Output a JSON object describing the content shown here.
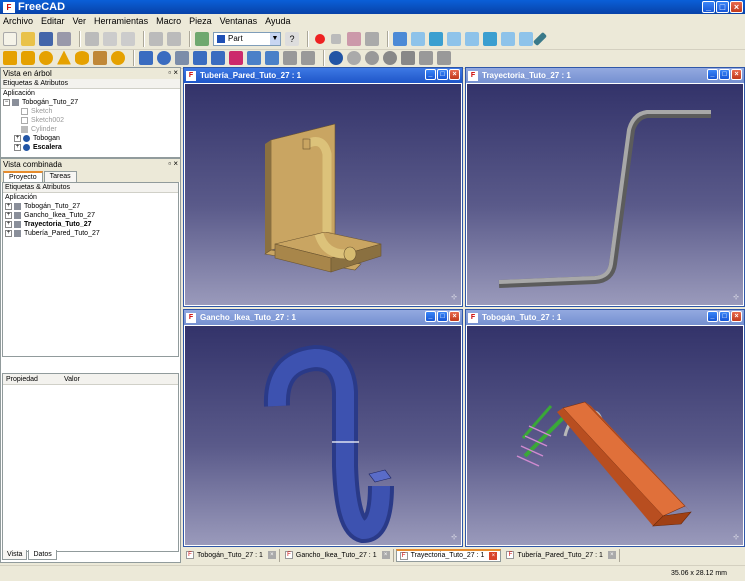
{
  "window": {
    "title": "FreeCAD"
  },
  "menu": [
    "Archivo",
    "Editar",
    "Ver",
    "Herramientas",
    "Macro",
    "Pieza",
    "Ventanas",
    "Ayuda"
  ],
  "toolbar": {
    "workbench": "Part"
  },
  "tree_panel": {
    "title": "Vista en árbol",
    "header": "Etiquetas & Atributos",
    "root": "Aplicación",
    "doc": "Tobogán_Tuto_27",
    "items": [
      "Sketch",
      "Sketch002",
      "Cylinder",
      "Tobogan",
      "Escalera"
    ]
  },
  "combo_panel": {
    "title": "Vista combinada",
    "tabs": [
      "Proyecto",
      "Tareas"
    ],
    "header": "Etiquetas & Atributos",
    "root": "Aplicación",
    "docs": [
      "Tobogán_Tuto_27",
      "Gancho_Ikea_Tuto_27",
      "Trayectoria_Tuto_27",
      "Tubería_Pared_Tuto_27"
    ],
    "prop_cols": [
      "Propiedad",
      "Valor"
    ],
    "bottom_tabs": [
      "Vista",
      "Datos"
    ]
  },
  "views": [
    {
      "title": "Tubería_Pared_Tuto_27 : 1"
    },
    {
      "title": "Trayectoria_Tuto_27 : 1"
    },
    {
      "title": "Gancho_Ikea_Tuto_27 : 1"
    },
    {
      "title": "Tobogán_Tuto_27 : 1"
    }
  ],
  "doc_tabs": [
    "Tobogán_Tuto_27 : 1",
    "Gancho_Ikea_Tuto_27 : 1",
    "Trayectoria_Tuto_27 : 1",
    "Tubería_Pared_Tuto_27 : 1"
  ],
  "status": {
    "dims": "35.06 x 28.12 mm"
  }
}
